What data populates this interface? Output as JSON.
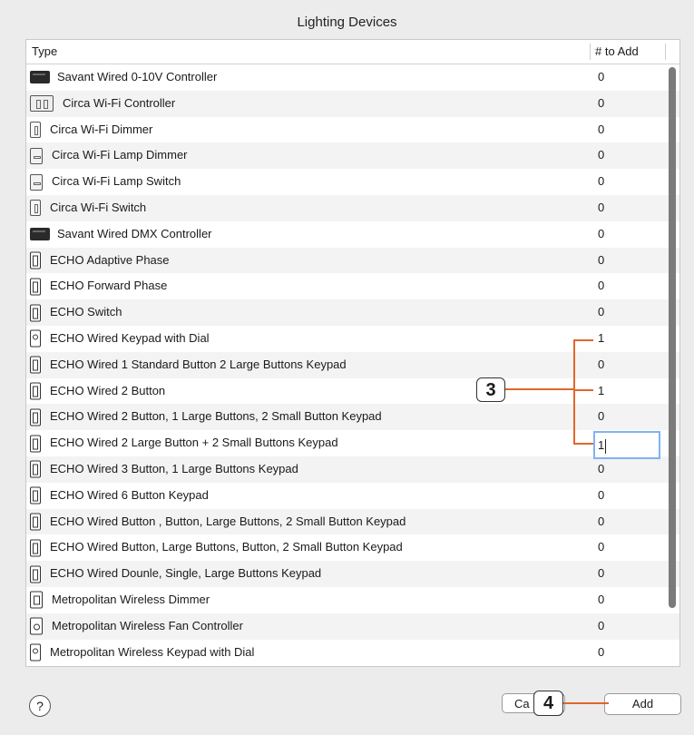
{
  "dialog": {
    "title": "Lighting Devices"
  },
  "table": {
    "columns": {
      "type": "Type",
      "count": "# to Add"
    },
    "rows": [
      {
        "name": "Savant Wired 0-10V Controller",
        "count": "0",
        "icon": "controller-icon"
      },
      {
        "name": "Circa Wi-Fi Controller",
        "count": "0",
        "icon": "double-switch-icon"
      },
      {
        "name": "Circa Wi-Fi Dimmer",
        "count": "0",
        "icon": "dimmer-icon"
      },
      {
        "name": "Circa Wi-Fi Lamp Dimmer",
        "count": "0",
        "icon": "lamp-dimmer-icon"
      },
      {
        "name": "Circa Wi-Fi Lamp Switch",
        "count": "0",
        "icon": "lamp-switch-icon"
      },
      {
        "name": "Circa Wi-Fi Switch",
        "count": "0",
        "icon": "switch-icon"
      },
      {
        "name": "Savant Wired DMX Controller",
        "count": "0",
        "icon": "controller-icon"
      },
      {
        "name": "ECHO Adaptive Phase",
        "count": "0",
        "icon": "keypad-icon"
      },
      {
        "name": "ECHO Forward Phase",
        "count": "0",
        "icon": "keypad-icon"
      },
      {
        "name": "ECHO Switch",
        "count": "0",
        "icon": "keypad-icon"
      },
      {
        "name": "ECHO Wired Keypad with Dial",
        "count": "1",
        "icon": "dial-keypad-icon"
      },
      {
        "name": "ECHO Wired 1 Standard Button 2 Large Buttons Keypad",
        "count": "0",
        "icon": "keypad-icon"
      },
      {
        "name": "ECHO Wired 2 Button",
        "count": "1",
        "icon": "keypad-icon"
      },
      {
        "name": "ECHO Wired 2 Button, 1 Large Buttons, 2 Small Button Keypad",
        "count": "0",
        "icon": "keypad-icon"
      },
      {
        "name": "ECHO Wired 2 Large Button + 2 Small Buttons Keypad",
        "count": "1",
        "icon": "keypad-icon"
      },
      {
        "name": "ECHO Wired 3 Button, 1 Large Buttons Keypad",
        "count": "0",
        "icon": "keypad-icon"
      },
      {
        "name": "ECHO Wired 6 Button Keypad",
        "count": "0",
        "icon": "keypad-icon"
      },
      {
        "name": "ECHO Wired  Button , Button,  Large Buttons, 2 Small Button Keypad",
        "count": "0",
        "icon": "keypad-icon"
      },
      {
        "name": "ECHO Wired  Button, Large Buttons, Button, 2 Small Button Keypad",
        "count": "0",
        "icon": "keypad-icon"
      },
      {
        "name": "ECHO Wired Dounle, Single, Large Buttons Keypad",
        "count": "0",
        "icon": "keypad-icon"
      },
      {
        "name": "Metropolitan Wireless Dimmer",
        "count": "0",
        "icon": "metro-dimmer-icon"
      },
      {
        "name": "Metropolitan Wireless Fan Controller",
        "count": "0",
        "icon": "fan-controller-icon"
      },
      {
        "name": "Metropolitan Wireless Keypad with Dial",
        "count": "0",
        "icon": "dial-keypad-icon"
      }
    ],
    "editing_value": "1"
  },
  "callouts": {
    "step3": "3",
    "step4": "4"
  },
  "footer": {
    "help_label": "?",
    "cancel_label": "Ca",
    "add_label": "Add"
  },
  "colors": {
    "callout_line": "#e0672a",
    "focus_ring": "#7fb3f0"
  }
}
